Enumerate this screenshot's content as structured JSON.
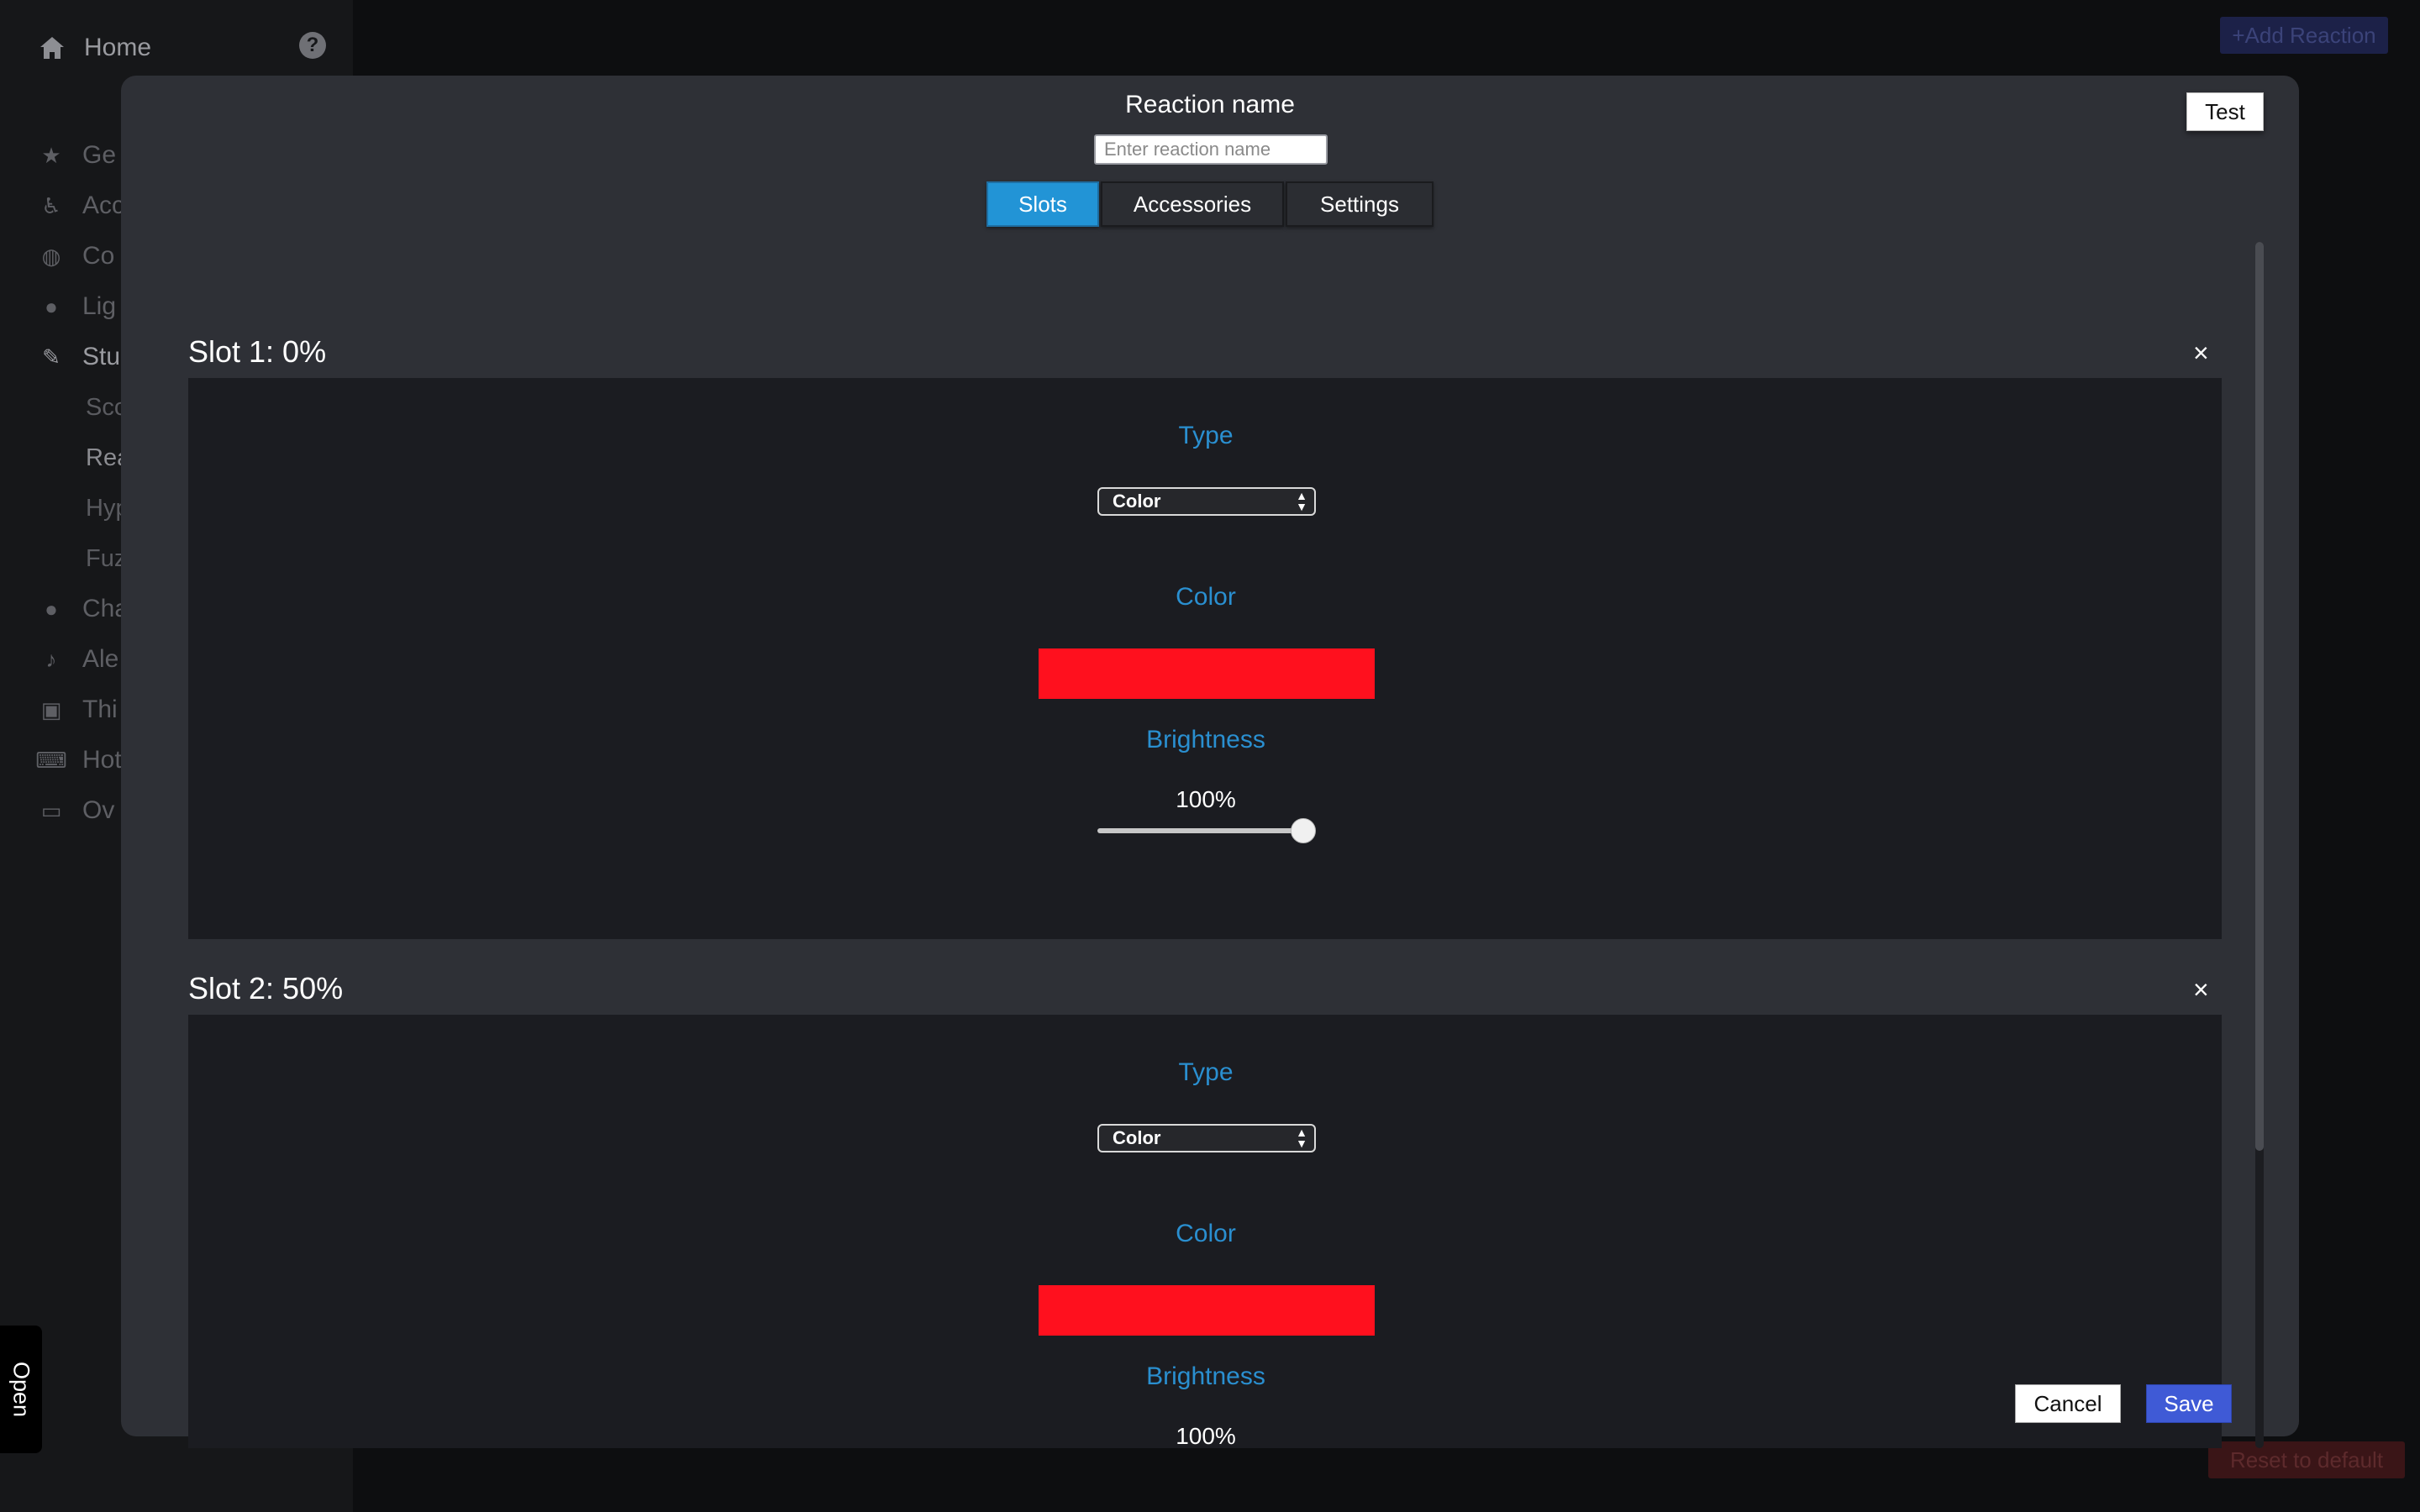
{
  "sidebar": {
    "home_label": "Home",
    "help_icon": "question-circle-icon",
    "items": [
      {
        "label": "Ge",
        "icon": "star-icon"
      },
      {
        "label": "Acc",
        "icon": "accessibility-icon"
      },
      {
        "label": "Co",
        "icon": "palette-icon"
      },
      {
        "label": "Lig",
        "icon": "lightbulb-icon"
      },
      {
        "label": "Stu",
        "icon": "brush-icon"
      },
      {
        "label": "Cha",
        "icon": "chat-icon"
      },
      {
        "label": "Ale",
        "icon": "bell-icon"
      },
      {
        "label": "Thi",
        "icon": "integrations-icon"
      },
      {
        "label": "Hot",
        "icon": "keyboard-icon"
      },
      {
        "label": "Ov",
        "icon": "monitor-icon"
      }
    ],
    "subitems": [
      "Sco",
      "Rea",
      "Hyp",
      "Fuz"
    ],
    "open_tab_label": "Open"
  },
  "background": {
    "add_reaction_label": "+Add Reaction",
    "reset_label": "Reset to default"
  },
  "modal": {
    "title": "Reaction name",
    "name_input": {
      "value": "",
      "placeholder": "Enter reaction name"
    },
    "test_label": "Test",
    "tabs": [
      {
        "label": "Slots",
        "active": true
      },
      {
        "label": "Accessories",
        "active": false
      },
      {
        "label": "Settings",
        "active": false
      }
    ],
    "slots": [
      {
        "title": "Slot 1: 0%",
        "close": "×",
        "type_label": "Type",
        "type_value": "Color",
        "color_label": "Color",
        "color": "#ff101e",
        "brightness_label": "Brightness",
        "brightness_text": "100%",
        "brightness": 1.0
      },
      {
        "title": "Slot 2: 50%",
        "close": "×",
        "type_label": "Type",
        "type_value": "Color",
        "color_label": "Color",
        "color": "#ff101e",
        "brightness_label": "Brightness",
        "brightness_text": "100%",
        "brightness": 1.0
      }
    ],
    "cancel_label": "Cancel",
    "save_label": "Save"
  }
}
